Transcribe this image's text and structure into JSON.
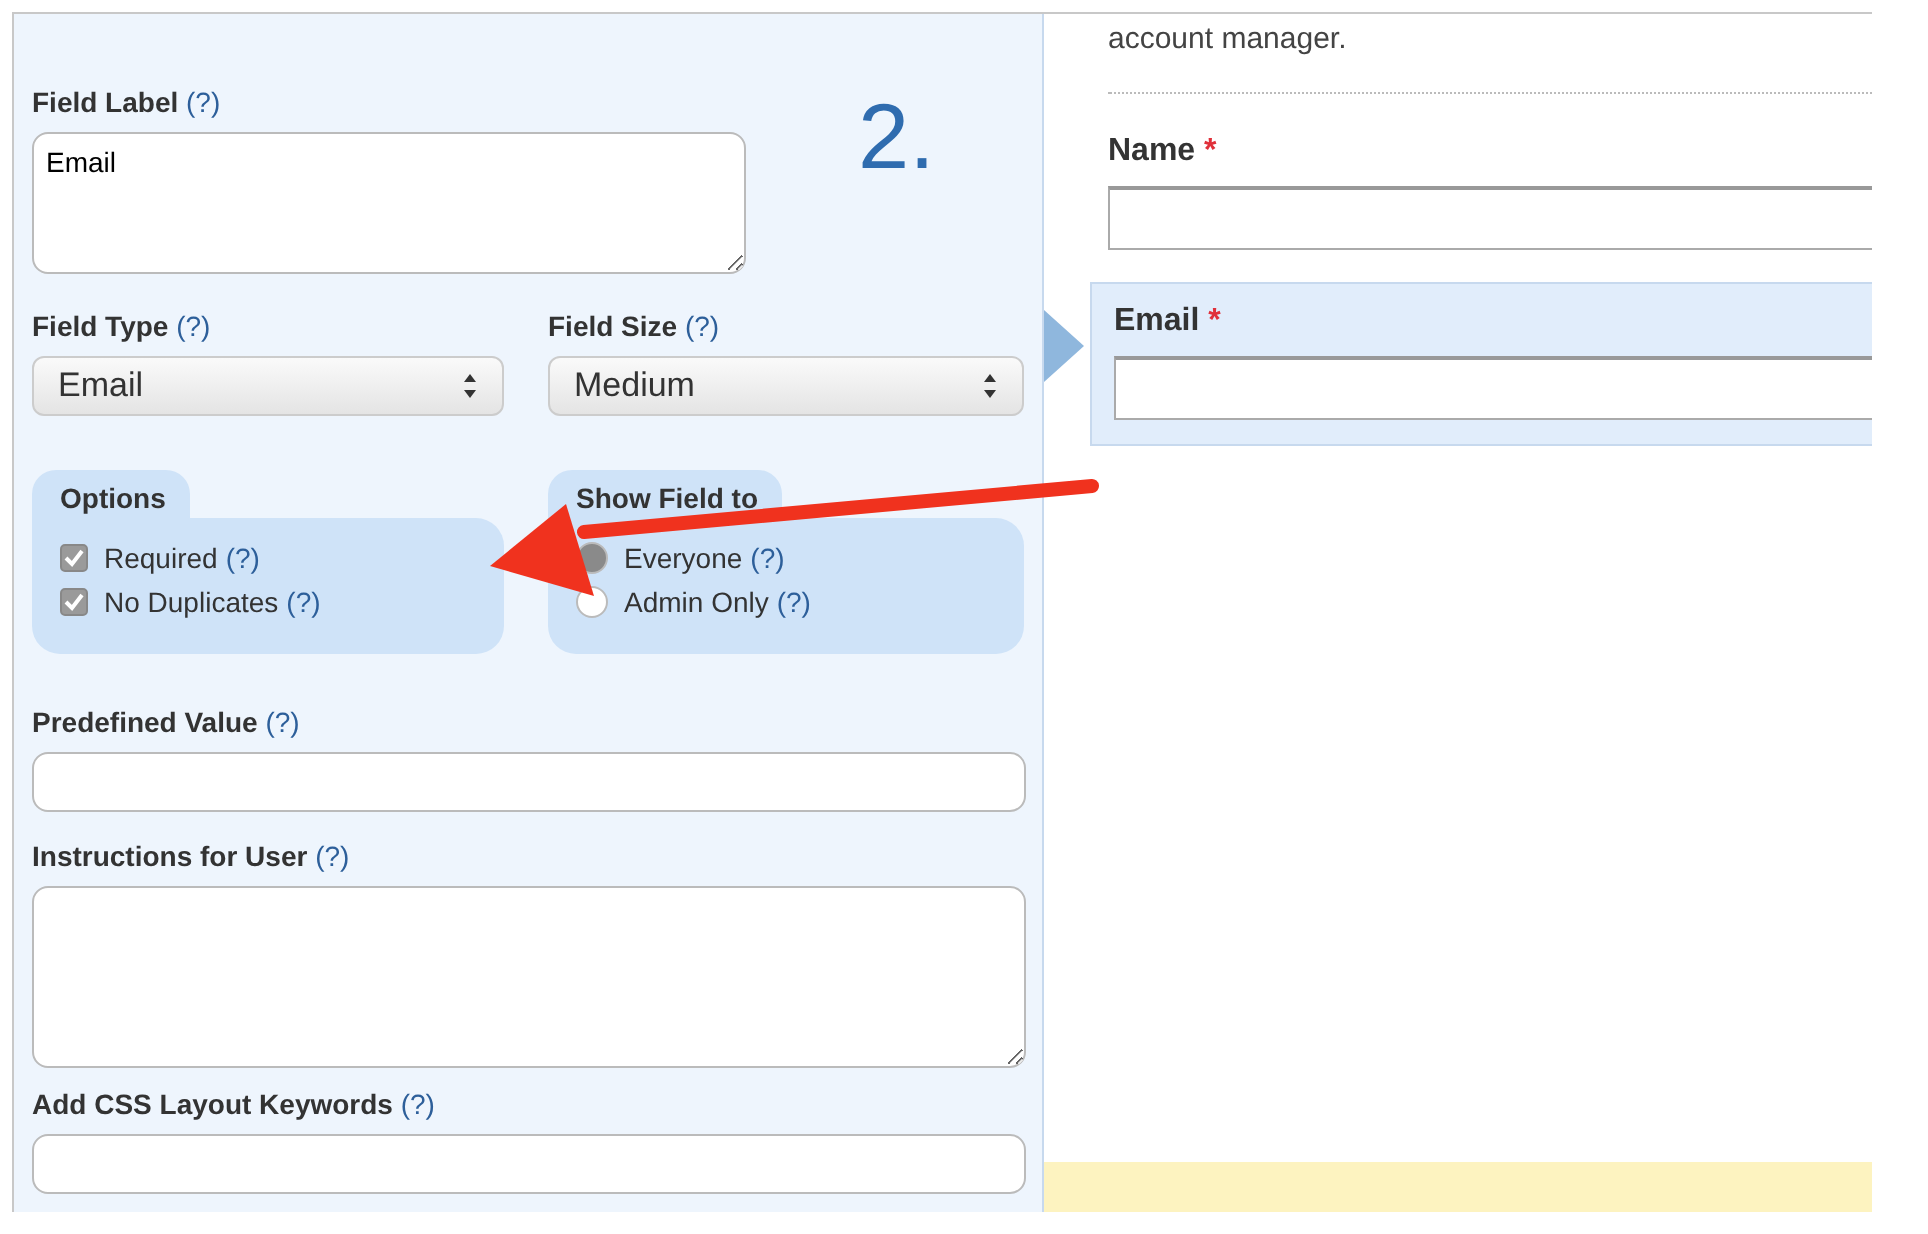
{
  "step_number": "2.",
  "left_panel": {
    "field_label": {
      "label": "Field Label",
      "help": "(?)",
      "value": "Email"
    },
    "field_type": {
      "label": "Field Type",
      "help": "(?)",
      "value": "Email"
    },
    "field_size": {
      "label": "Field Size",
      "help": "(?)",
      "value": "Medium"
    },
    "options": {
      "legend": "Options",
      "items": [
        {
          "label": "Required",
          "help": "(?)",
          "checked": true
        },
        {
          "label": "No Duplicates",
          "help": "(?)",
          "checked": true
        }
      ]
    },
    "show_field_to": {
      "legend": "Show Field to",
      "items": [
        {
          "label": "Everyone",
          "help": "(?)",
          "selected": true
        },
        {
          "label": "Admin Only",
          "help": "(?)",
          "selected": false
        }
      ]
    },
    "predefined_value": {
      "label": "Predefined Value",
      "help": "(?)"
    },
    "instructions": {
      "label": "Instructions for User",
      "help": "(?)"
    },
    "css_keywords": {
      "label": "Add CSS Layout Keywords",
      "help": "(?)"
    }
  },
  "preview": {
    "intro_text": "account manager.",
    "fields": [
      {
        "label": "Name",
        "required_mark": "*",
        "highlighted": false
      },
      {
        "label": "Email",
        "required_mark": "*",
        "highlighted": true
      }
    ]
  }
}
